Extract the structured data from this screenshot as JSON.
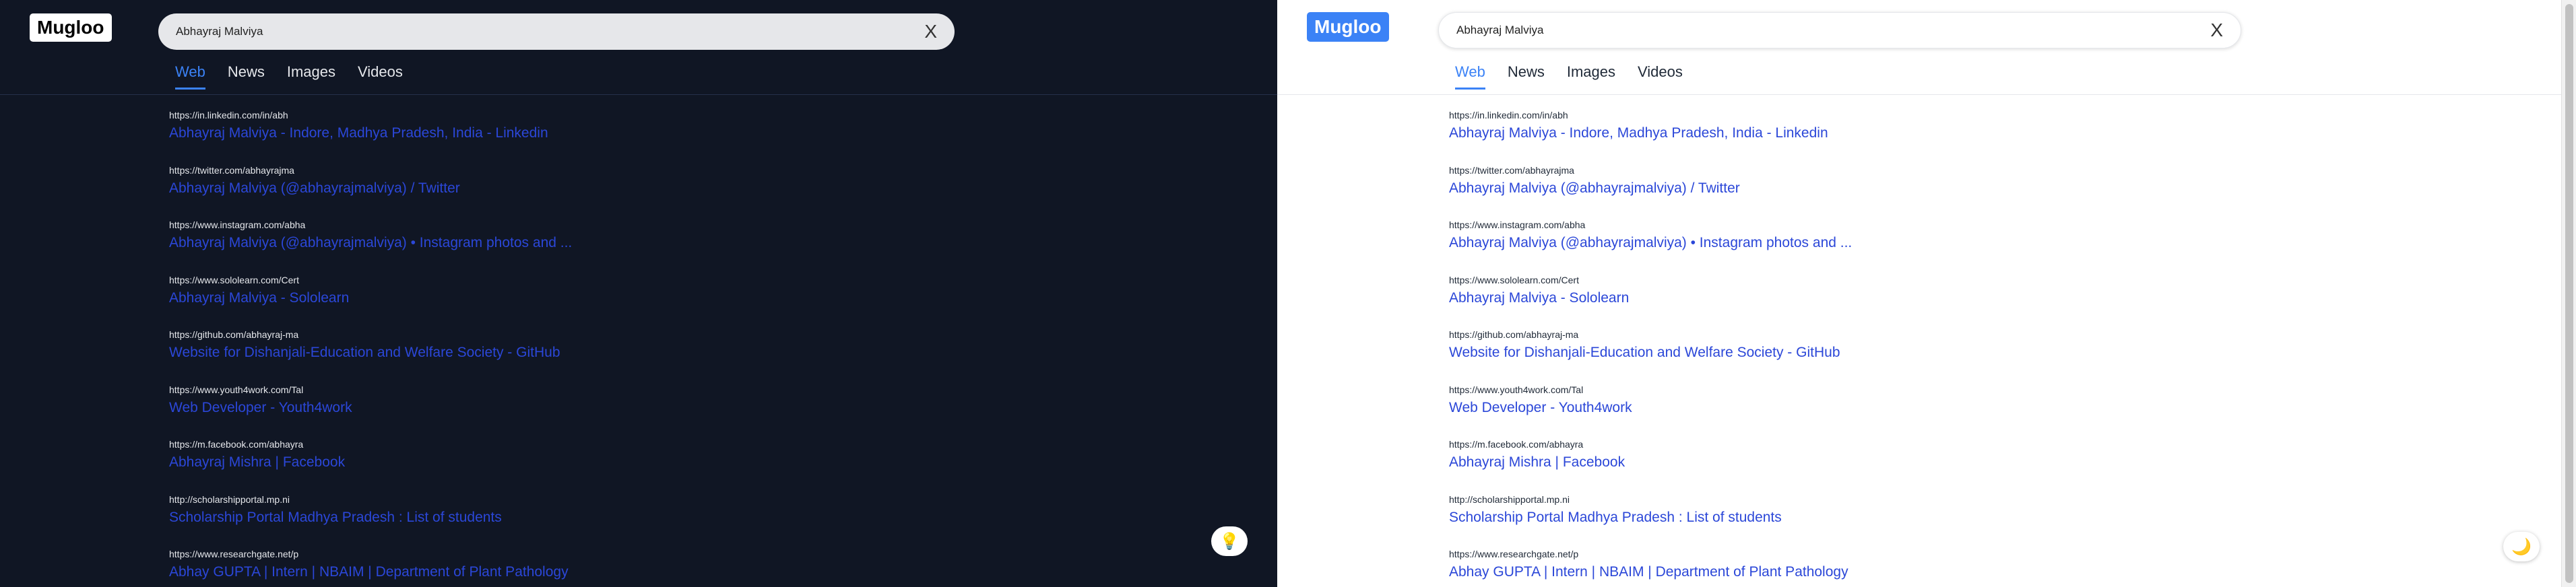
{
  "logo": "Mugloo",
  "search": {
    "value": "Abhayraj Malviya",
    "clear": "X"
  },
  "tabs": [
    {
      "label": "Web",
      "active": true
    },
    {
      "label": "News",
      "active": false
    },
    {
      "label": "Images",
      "active": false
    },
    {
      "label": "Videos",
      "active": false
    }
  ],
  "results": [
    {
      "url": "https://in.linkedin.com/in/abh",
      "title": "Abhayraj Malviya - Indore, Madhya Pradesh, India - Linkedin"
    },
    {
      "url": "https://twitter.com/abhayrajma",
      "title": "Abhayraj Malviya (@abhayrajmalviya) / Twitter"
    },
    {
      "url": "https://www.instagram.com/abha",
      "title": "Abhayraj Malviya (@abhayrajmalviya) • Instagram photos and ..."
    },
    {
      "url": "https://www.sololearn.com/Cert",
      "title": "Abhayraj Malviya - Sololearn"
    },
    {
      "url": "https://github.com/abhayraj-ma",
      "title": "Website for Dishanjali-Education and Welfare Society - GitHub"
    },
    {
      "url": "https://www.youth4work.com/Tal",
      "title": "Web Developer - Youth4work"
    },
    {
      "url": "https://m.facebook.com/abhayra",
      "title": "Abhayraj Mishra | Facebook"
    },
    {
      "url": "http://scholarshipportal.mp.ni",
      "title": "Scholarship Portal Madhya Pradesh : List of students"
    },
    {
      "url": "https://www.researchgate.net/p",
      "title": "Abhay GUPTA | Intern | NBAIM | Department of Plant Pathology"
    }
  ],
  "theme_toggle": {
    "dark_mode_icon": "💡",
    "light_mode_icon": "🌙"
  },
  "colors": {
    "dark_background": "#101624",
    "accent": "#3b82f6",
    "link": "#2b47d8"
  }
}
